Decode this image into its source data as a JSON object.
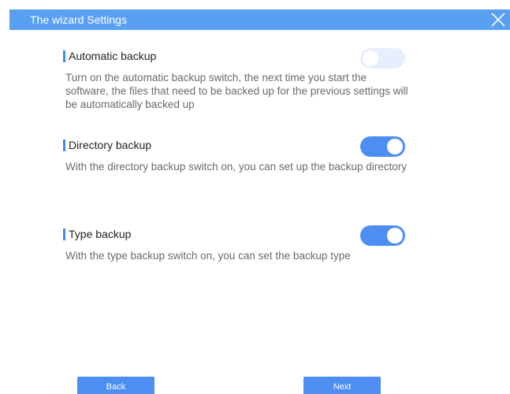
{
  "window": {
    "title": "The wizard Settings"
  },
  "sections": [
    {
      "title": "Automatic backup",
      "description": "Turn on the automatic backup switch, the next time you start the software, the files that need to be backed up for the previous settings will be automatically backed up",
      "enabled": false
    },
    {
      "title": "Directory backup",
      "description": "With the directory backup switch on, you can set up the backup directory",
      "enabled": true
    },
    {
      "title": "Type backup",
      "description": "With the type backup switch on, you can set the backup type",
      "enabled": true
    }
  ],
  "footer": {
    "back_label": "Back",
    "next_label": "Next"
  },
  "colors": {
    "accent": "#4e8ef3",
    "titlebar": "#5aa0f2",
    "toggle_off": "#e5effd"
  },
  "icons": {
    "close": "close-icon"
  }
}
